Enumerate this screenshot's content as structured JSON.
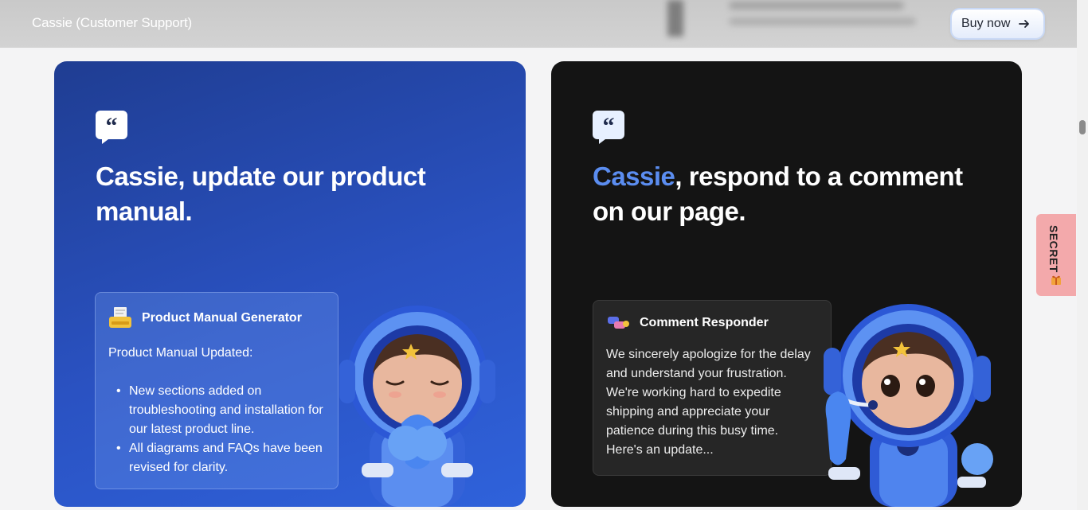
{
  "header": {
    "title": "Cassie (Customer Support)",
    "buy_label": "Buy now"
  },
  "cards": [
    {
      "heading_accent": "",
      "heading_rest": "Cassie, update our product manual.",
      "panel": {
        "title": "Product Manual Generator",
        "intro": "Product Manual Updated:",
        "bullets": [
          "New sections added on troubleshooting and installation for our latest product line.",
          "All diagrams and FAQs have been revised for clarity."
        ]
      }
    },
    {
      "heading_accent": "Cassie",
      "heading_rest": ", respond to a comment on our page.",
      "panel": {
        "title": "Comment Responder",
        "body": "We sincerely apologize for the delay and understand your frustration. We're working hard to expedite shipping and appreciate your patience during this busy time. Here's an update..."
      }
    }
  ],
  "side_tab": {
    "label": "SECRET",
    "icon": "gift-icon"
  },
  "colors": {
    "blue_card": "#2a52c2",
    "dark_card": "#141414",
    "accent": "#5b8df0",
    "secret_tab": "#f3a9ab"
  }
}
